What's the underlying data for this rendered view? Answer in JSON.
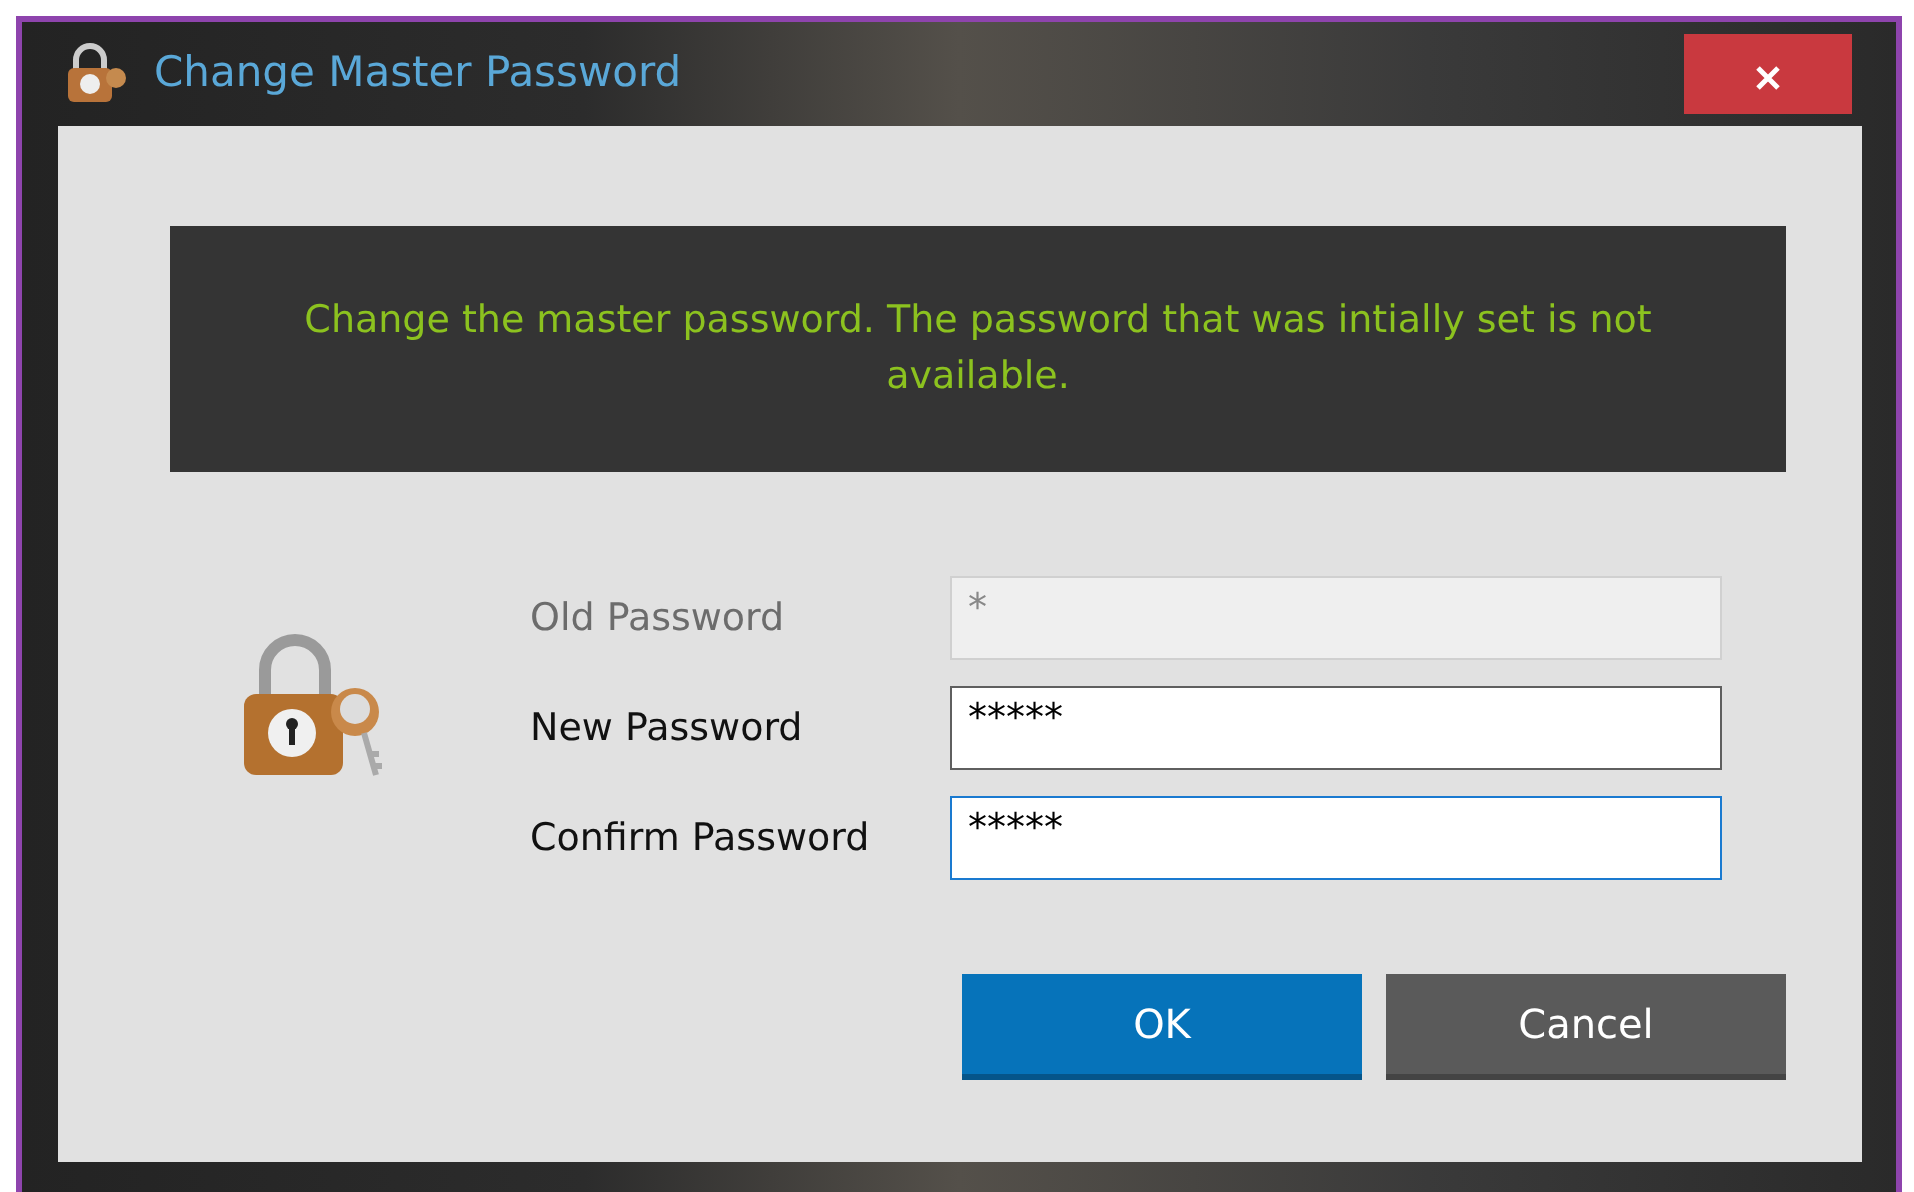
{
  "window": {
    "title": "Change Master Password"
  },
  "message": "Change the master password. The password that was intially set is not available.",
  "fields": [
    {
      "label": "Old Password",
      "value": "*",
      "disabled": true,
      "focused": false
    },
    {
      "label": "New Password",
      "value": "*****",
      "disabled": false,
      "focused": false
    },
    {
      "label": "Confirm Password",
      "value": "*****",
      "disabled": false,
      "focused": true
    }
  ],
  "buttons": [
    {
      "label": "OK",
      "kind": "primary"
    },
    {
      "label": "Cancel",
      "kind": "secondary"
    }
  ]
}
